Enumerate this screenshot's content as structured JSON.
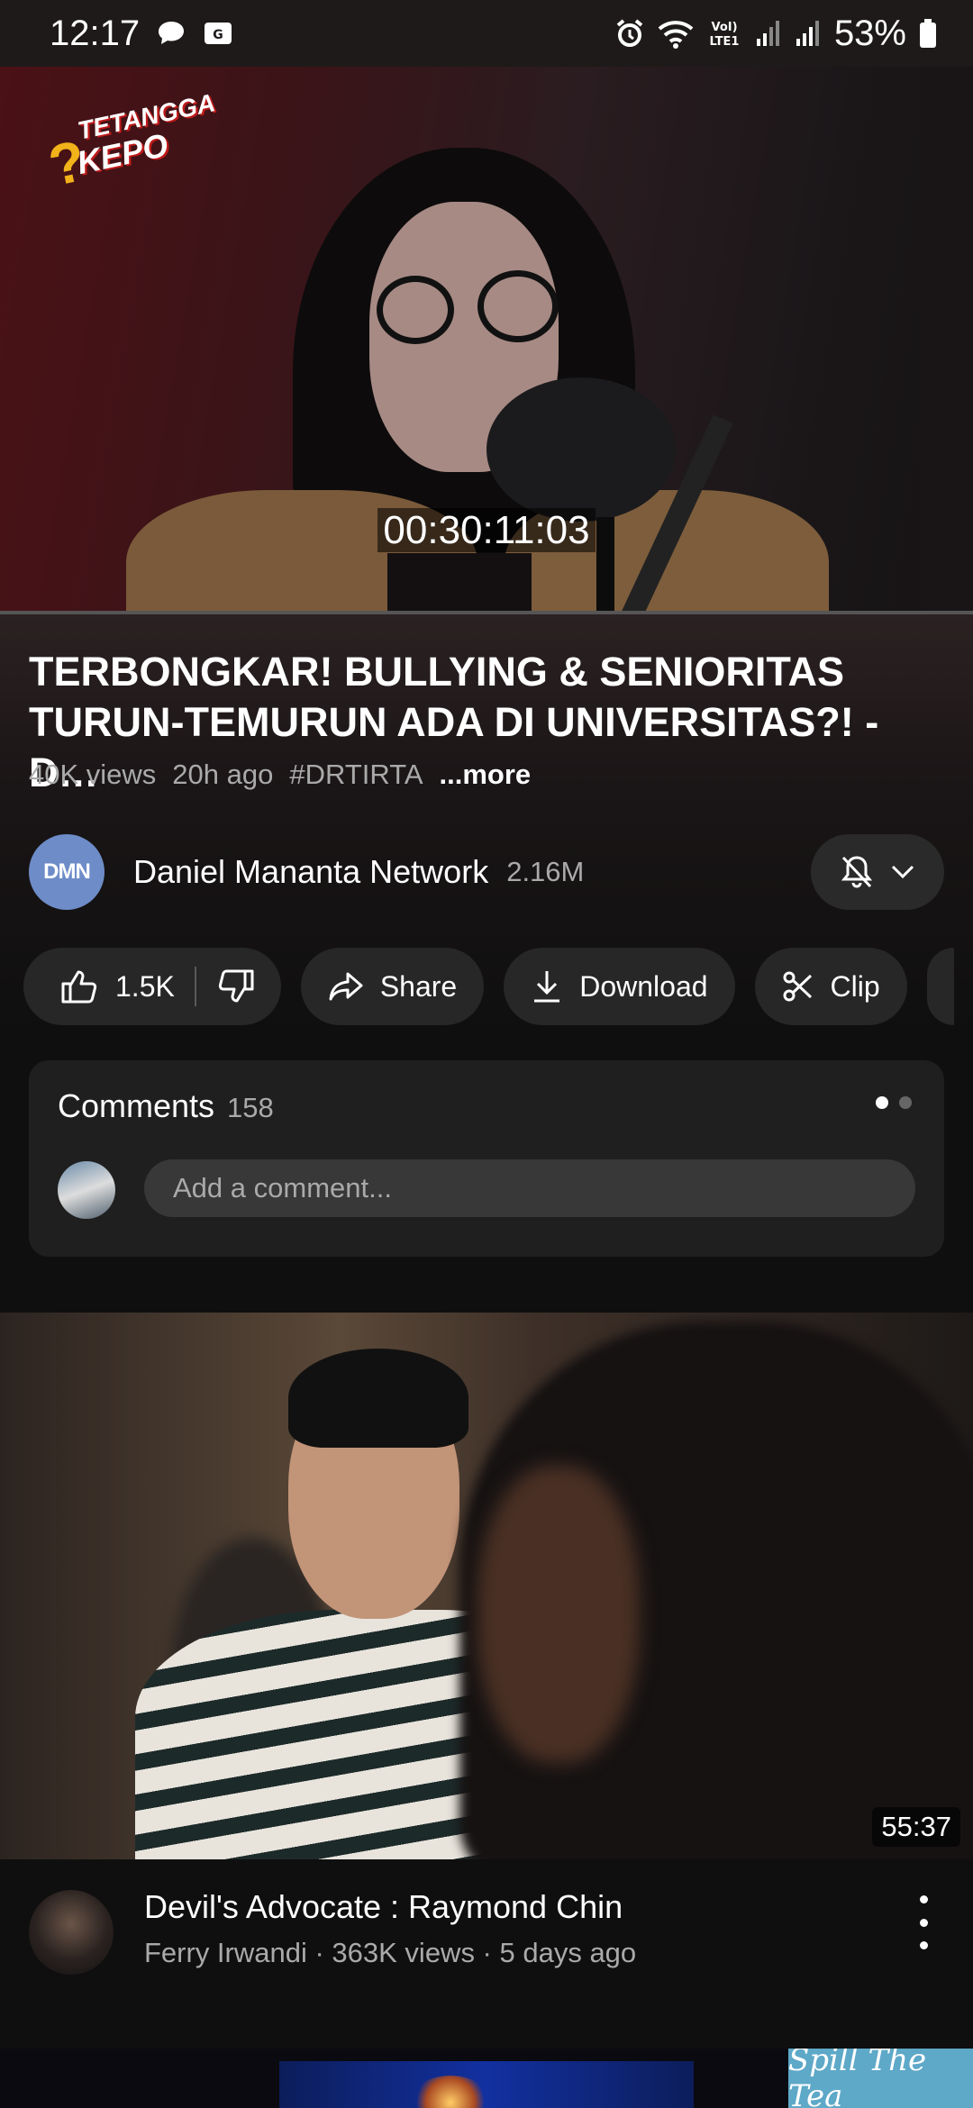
{
  "status_bar": {
    "time": "12:17",
    "battery": "53%",
    "icons_left": [
      "chat-bubble-icon",
      "gallery-icon"
    ],
    "icons_right": [
      "alarm-icon",
      "wifi-icon",
      "volte-icon",
      "signal-icon",
      "signal-icon",
      "battery-icon"
    ]
  },
  "player": {
    "timecode": "00:30:11:03",
    "progress": 0.0,
    "logo_line1": "TETANGGA",
    "logo_line2": "KEPO",
    "logo_mark": "?"
  },
  "video": {
    "title": "TERBONGKAR! BULLYING & SENIORITAS TURUN-TEMURUN ADA DI UNIVERSITAS?! - D…",
    "views": "40K views",
    "age": "20h ago",
    "hashtag": "#DRTIRTA",
    "more": "...more"
  },
  "channel": {
    "avatar_text": "DMN",
    "name": "Daniel Mananta Network",
    "subscribers": "2.16M",
    "bell_icon": "bell-off-icon",
    "chevron_icon": "chevron-down-icon"
  },
  "actions": {
    "likes": "1.5K",
    "share": "Share",
    "download": "Download",
    "clip": "Clip"
  },
  "comments": {
    "title": "Comments",
    "count": "158",
    "placeholder": "Add a comment..."
  },
  "recommended": [
    {
      "title": "Devil's Advocate : Raymond Chin",
      "meta": "Ferry Irwandi · 363K views · 5 days ago",
      "duration": "55:37"
    }
  ],
  "next_badge": "Spill The Tea",
  "colors": {
    "background": "#0f0f0f",
    "pill": "#272727",
    "card": "#1f1f1f",
    "secondary_text": "#aaaaaa"
  }
}
